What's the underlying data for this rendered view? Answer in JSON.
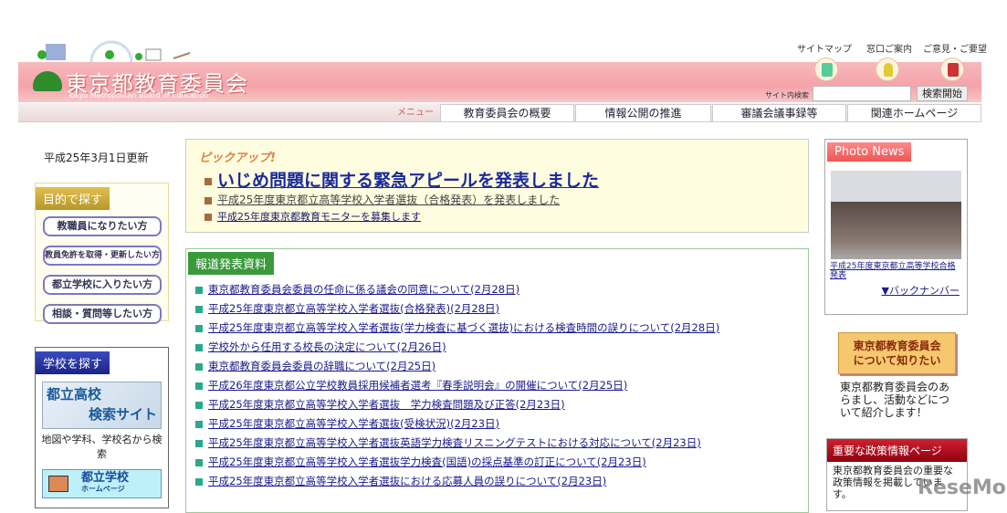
{
  "header": {
    "title": "東京都教育委員会",
    "subtitle": "Tokyo Metropolitan Board of Education",
    "top_links": [
      {
        "label": "サイトマップ",
        "icon": "sitemap-icon"
      },
      {
        "label": "窓口ご案内",
        "icon": "reception-icon"
      },
      {
        "label": "ご意見・ご要望",
        "icon": "mailbox-icon"
      }
    ],
    "search_label": "サイト内検索",
    "search_value": "",
    "search_button": "検索開始"
  },
  "nav": {
    "menu_label": "メニュー",
    "tabs": [
      "教育委員会の概要",
      "情報公開の推進",
      "審議会議事録等",
      "関連ホームページ"
    ]
  },
  "left": {
    "updated": "平成25年3月1日更新",
    "purpose_title": "目的で探す",
    "purpose_buttons": [
      "教職員になりたい方",
      "教員免許を取得・更新したい方",
      "都立学校に入りたい方",
      "相談・質問等したい方"
    ],
    "school_title": "学校を探す",
    "school_search_banner": [
      "都立高校",
      "検索サイト"
    ],
    "school_search_caption": "地図や学科、学校名から検索",
    "school_hp_banner": [
      "都立学校",
      "ホームページ"
    ]
  },
  "pickup": {
    "label": "ピックアップ!",
    "headline": "いじめ問題に関する緊急アピールを発表しました",
    "items": [
      "平成25年度東京都立高等学校入学者選抜（合格発表）を発表しました",
      "平成25年度東京都教育モニターを募集します"
    ]
  },
  "press": {
    "title": "報道発表資料",
    "items": [
      "東京都教育委員会委員の任命に係る議会の同意について(2月28日)",
      "平成25年度東京都立高等学校入学者選抜(合格発表)(2月28日)",
      "平成25年度東京都立高等学校入学者選抜(学力検査に基づく選抜)における検査時間の誤りについて(2月28日)",
      "学校外から任用する校長の決定について(2月26日)",
      "東京都教育委員会委員の辞職について(2月25日)",
      "平成26年度東京都公立学校教員採用候補者選考『春季説明会』の開催について(2月25日)",
      "平成25年度東京都立高等学校入学者選抜　学力検査問題及び正答(2月23日)",
      "平成25年度東京都立高等学校入学者選抜(受検状況)(2月23日)",
      "平成25年度東京都立高等学校入学者選抜英語学力検査リスニングテストにおける対応について(2月23日)",
      "平成25年度東京都立高等学校入学者選抜学力検査(国語)の採点基準の訂正について(2月23日)",
      "平成25年度東京都立高等学校入学者選抜における応募人員の誤りについて(2月23日)"
    ]
  },
  "right": {
    "photo_title": "Photo News",
    "photo_caption": "平成25年度東京都立高等学校合格発表",
    "back_number": "▼バックナンバー",
    "about_button": [
      "東京都教育委員会",
      "について知りたい"
    ],
    "about_text": "東京都教育委員会のあらまし、活動などについて紹介します！",
    "policy_title": "重要な政策情報ページ",
    "policy_text": "東京都教育委員会の重要な政策情報を掲載しています。"
  },
  "watermark": "ReseMom",
  "colors": {
    "header_pink": "#f5a3a8",
    "press_green": "#3a9a3a",
    "bullet_green": "#2aa88a",
    "purpose_gold": "#c9a82a",
    "school_blue": "#23339a",
    "policy_red": "#b01020"
  }
}
